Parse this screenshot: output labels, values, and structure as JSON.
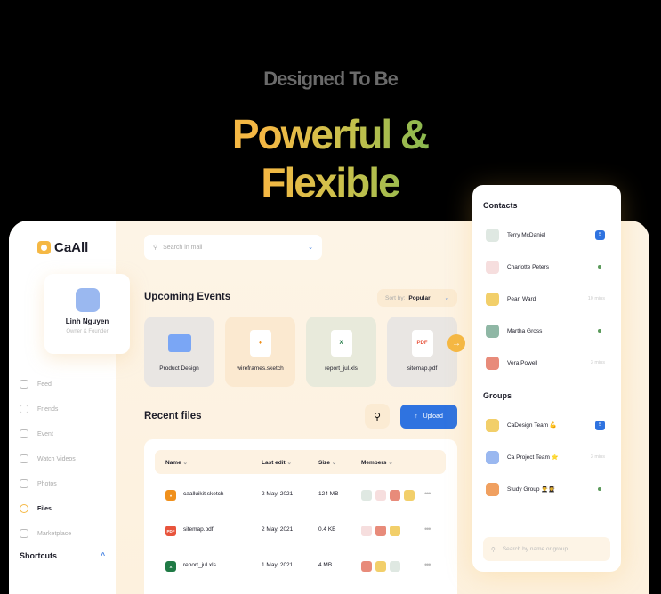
{
  "hero": {
    "subtitle": "Designed To Be",
    "title": "Powerful & Flexible"
  },
  "brand": {
    "name": "CaAll",
    "accent": "#f5b844",
    "primary": "#2f73e0"
  },
  "profile": {
    "name": "Linh Nguyen",
    "role": "Owner & Founder"
  },
  "nav": [
    {
      "label": "Feed",
      "icon": "grid-icon"
    },
    {
      "label": "Friends",
      "icon": "users-icon"
    },
    {
      "label": "Event",
      "icon": "calendar-icon"
    },
    {
      "label": "Watch Videos",
      "icon": "video-icon"
    },
    {
      "label": "Photos",
      "icon": "image-icon"
    },
    {
      "label": "Files",
      "icon": "file-icon",
      "active": true
    },
    {
      "label": "Marketplace",
      "icon": "cart-icon"
    }
  ],
  "shortcuts": {
    "label": "Shortcuts",
    "toggle": "^"
  },
  "search": {
    "placeholder": "Search in mail",
    "chev": "⌄"
  },
  "events": {
    "title": "Upcoming Events",
    "sort_label": "Sort by:",
    "sort_value": "Popular",
    "cards": [
      {
        "label": "Product Design",
        "icon": "folder-icon",
        "bg": "#e9e6e3"
      },
      {
        "label": "wireframes.sketch",
        "icon": "sketch-icon",
        "bg": "#fbe9d0",
        "glyph": "♦"
      },
      {
        "label": "report_jul.xls",
        "icon": "excel-icon",
        "bg": "#e8eadb",
        "glyph": "X"
      },
      {
        "label": "sitemap.pdf",
        "icon": "pdf-icon",
        "bg": "#e9e6e3",
        "glyph": "PDF"
      }
    ],
    "next": "→"
  },
  "recent": {
    "title": "Recent files",
    "upload": "Upload",
    "columns": [
      "Name",
      "Last edit",
      "Size",
      "Members"
    ],
    "rows": [
      {
        "name": "caalluikit.sketch",
        "edit": "2 May, 2021",
        "size": "124 MB",
        "type": "sketch",
        "members": 4
      },
      {
        "name": "sitemap.pdf",
        "edit": "2 May, 2021",
        "size": "0.4 KB",
        "type": "pdf",
        "members": 3
      },
      {
        "name": "report_jul.xls",
        "edit": "1 May, 2021",
        "size": "4 MB",
        "type": "xls",
        "members": 3
      }
    ]
  },
  "contacts": {
    "title": "Contacts",
    "items": [
      {
        "name": "Terry McDaniel",
        "badge": "5",
        "color": "#dfe8e2"
      },
      {
        "name": "Charlotte Peters",
        "online": true,
        "color": "#f6dede"
      },
      {
        "name": "Pearl Ward",
        "time": "10 mins",
        "color": "#f2cf6a"
      },
      {
        "name": "Martha Gross",
        "online": true,
        "color": "#8fb7a5"
      },
      {
        "name": "Vera Powell",
        "time": "3 mins",
        "color": "#e88b7a"
      }
    ],
    "groups_title": "Groups",
    "groups": [
      {
        "name": "CaDesign Team 💪",
        "badge": "5",
        "color": "#f2cf6a"
      },
      {
        "name": "Ca Project Team ⭐",
        "time": "3 mins",
        "color": "#9ab8f0"
      },
      {
        "name": "Study Group 👨‍🎓👩‍🎓",
        "online": true,
        "color": "#f0a060"
      }
    ],
    "search_placeholder": "Search by name or group"
  }
}
